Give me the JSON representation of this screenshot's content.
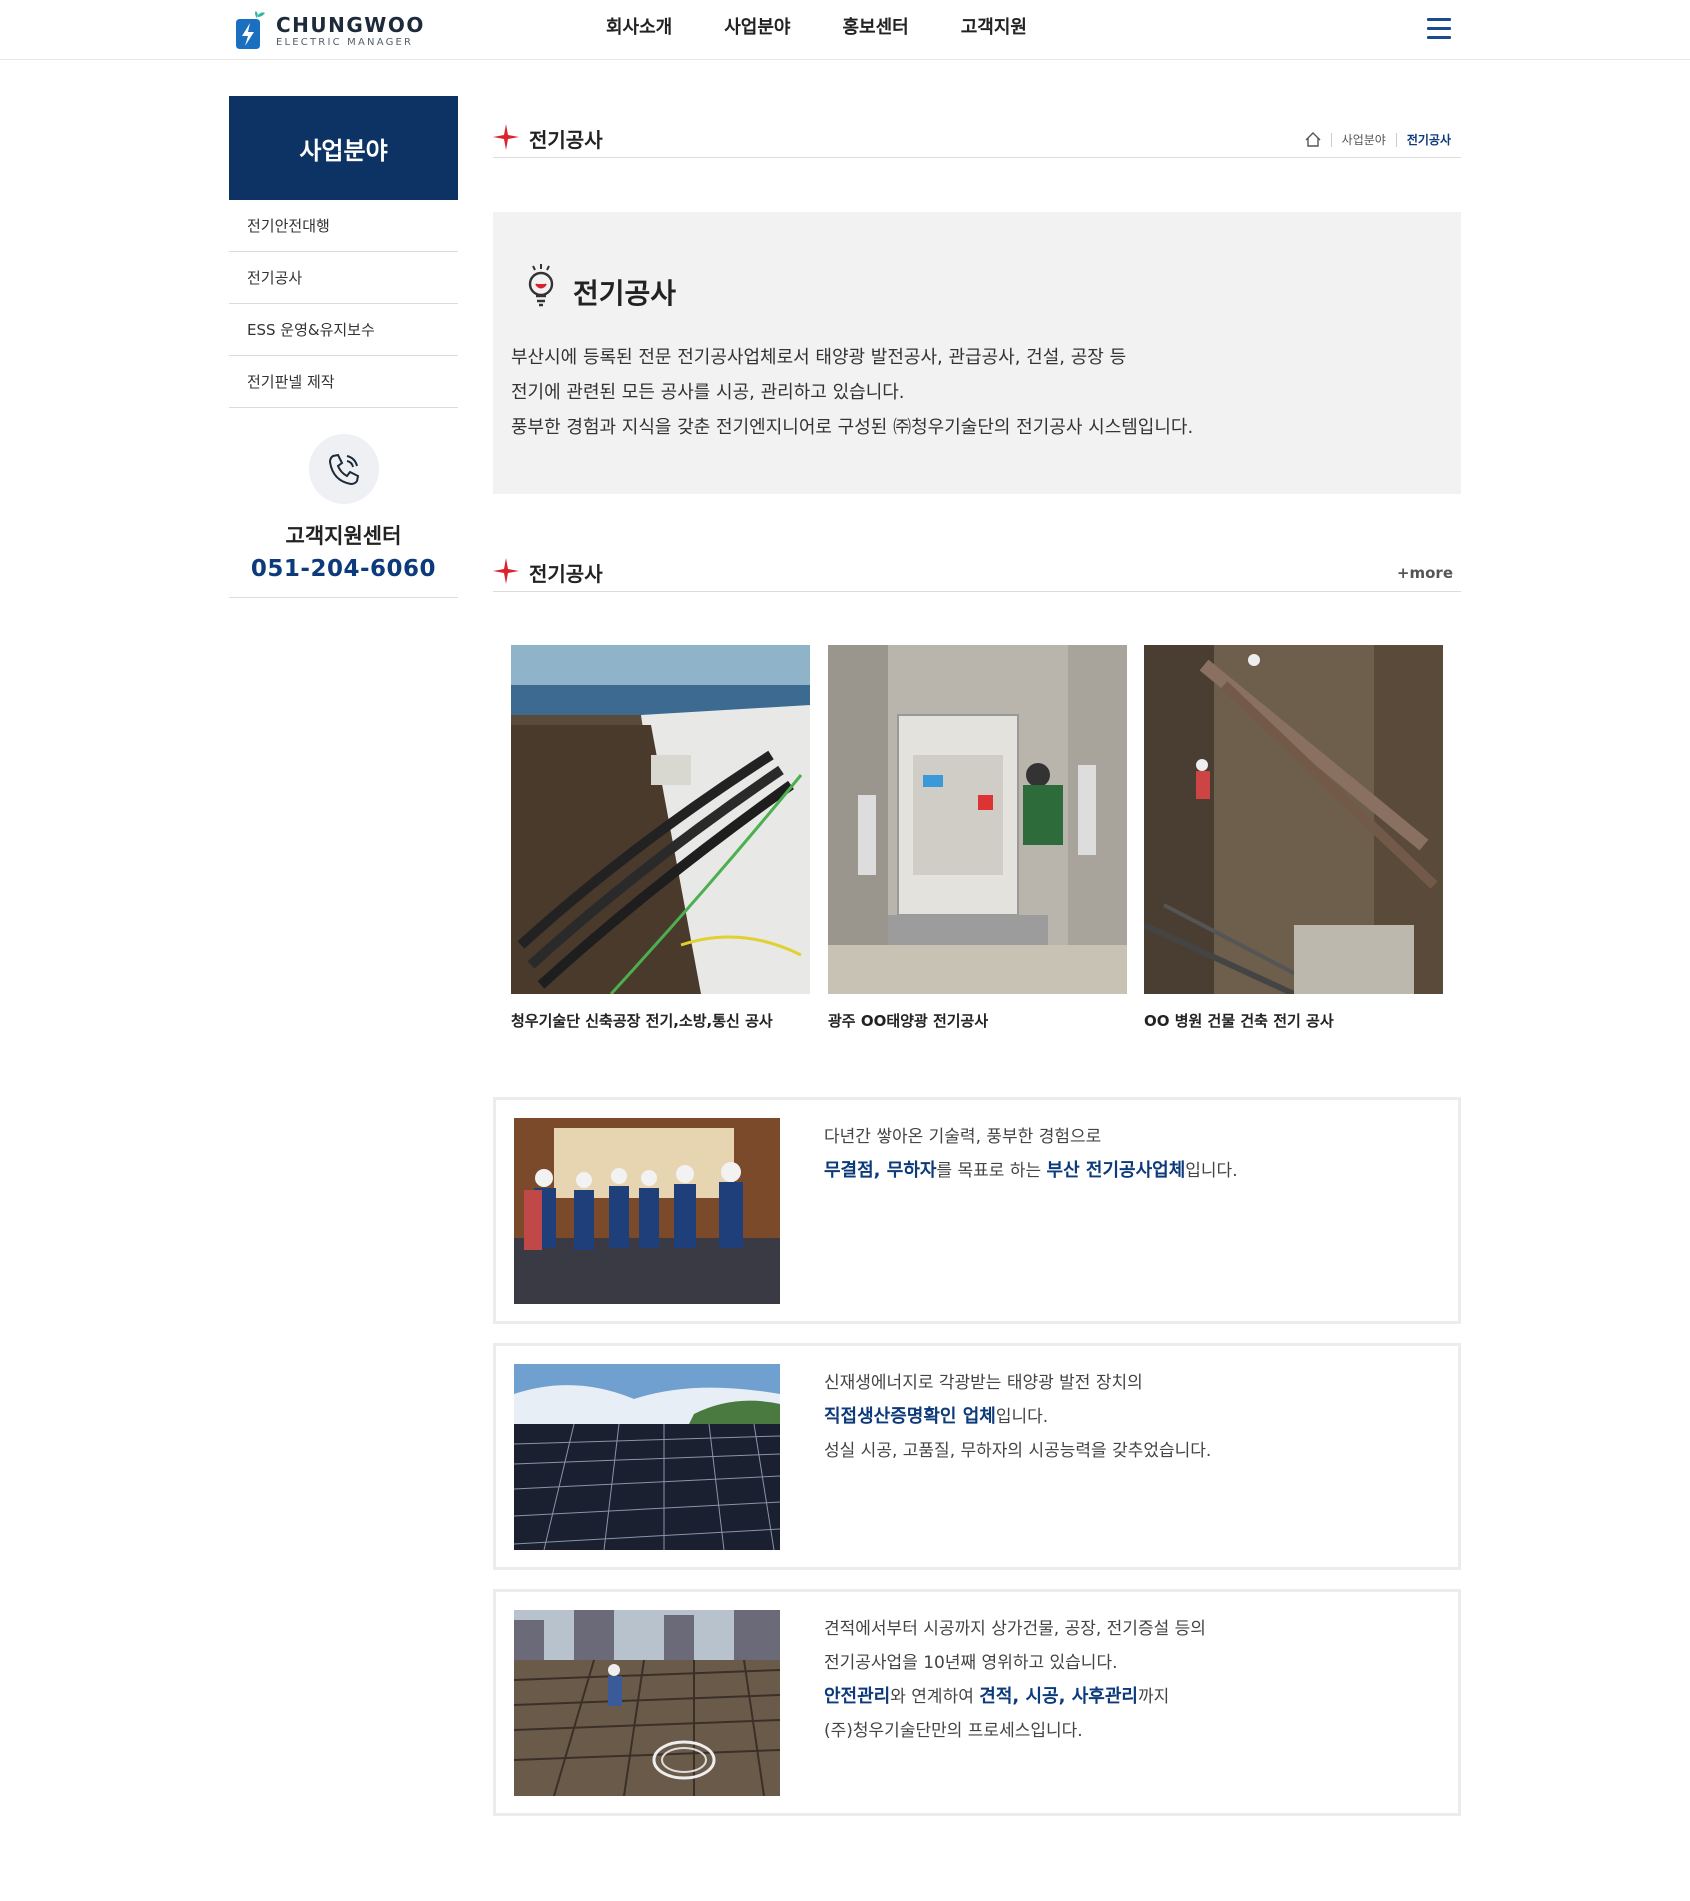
{
  "header": {
    "logo_name": "CHUNGWOO",
    "logo_sub": "ELECTRIC MANAGER",
    "nav": [
      "회사소개",
      "사업분야",
      "홍보센터",
      "고객지원"
    ]
  },
  "sidebar": {
    "title": "사업분야",
    "items": [
      "전기안전대행",
      "전기공사",
      "ESS 운영&유지보수",
      "전기판넬 제작"
    ],
    "support_title": "고객지원센터",
    "support_phone": "051-204-6060"
  },
  "page": {
    "title": "전기공사",
    "breadcrumb": [
      "사업분야",
      "전기공사"
    ]
  },
  "intro": {
    "title": "전기공사",
    "lines": [
      "부산시에 등록된 전문 전기공사업체로서 태양광 발전공사, 관급공사, 건설, 공장 등",
      "전기에 관련된 모든 공사를 시공, 관리하고 있습니다.",
      "풍부한 경험과 지식을 갖춘 전기엔지니어로 구성된 ㈜청우기술단의 전기공사 시스템입니다."
    ]
  },
  "gallery": {
    "title": "전기공사",
    "more_label": "+more",
    "items": [
      {
        "caption": "청우기술단 신축공장 전기,소방,통신 공사"
      },
      {
        "caption": "광주 OO태양광 전기공사"
      },
      {
        "caption": "OO 병원 건물 건축 전기 공사"
      }
    ]
  },
  "features": [
    {
      "line1": "다년간 쌓아온 기술력, 풍부한 경험으로",
      "hl1": "무결점, 무하자",
      "mid": "를 목표로 하는 ",
      "hl2": "부산 전기공사업체",
      "end": "입니다."
    },
    {
      "line1": "신재생에너지로 각광받는 태양광 발전 장치의",
      "hl1": "직접생산증명확인 업체",
      "end": "입니다.",
      "line3": "성실 시공, 고품질, 무하자의 시공능력을 갖추었습니다."
    },
    {
      "line1": "견적에서부터 시공까지 상가건물, 공장, 전기증설 등의",
      "line2": "전기공사업을 10년째 영위하고 있습니다.",
      "hl1": "안전관리",
      "mid": "와 연계하여 ",
      "hl2": "견적, 시공, 사후관리",
      "end": "까지",
      "line4": "(주)청우기술단만의 프로세스입니다."
    }
  ],
  "colors": {
    "navy": "#0d3264",
    "accent_blue": "#0d3a7a",
    "star_red": "#d9232d"
  }
}
